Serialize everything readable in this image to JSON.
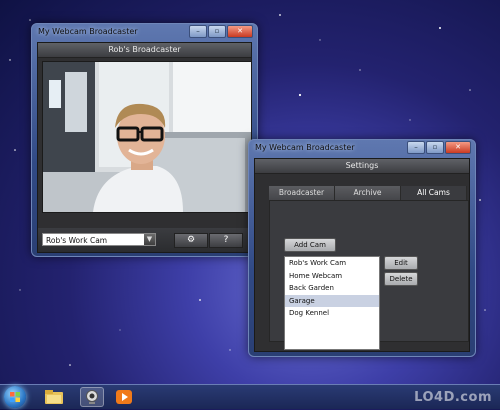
{
  "main_window": {
    "title": "My Webcam Broadcaster",
    "panel_title": "Rob's Broadcaster",
    "camera_select": "Rob's Work Cam",
    "settings_button": "⚙",
    "help_button": "?"
  },
  "settings_window": {
    "title": "My Webcam Broadcaster",
    "panel_title": "Settings",
    "tabs": [
      "Broadcaster",
      "Archive",
      "All Cams"
    ],
    "active_tab": "All Cams",
    "add_cam_label": "Add Cam",
    "edit_label": "Edit",
    "delete_label": "Delete",
    "cameras": [
      "Rob's Work Cam",
      "Home Webcam",
      "Back Garden",
      "Garage",
      "Dog Kennel"
    ],
    "selected_camera": "Garage"
  },
  "watermark": "LO4D.com"
}
